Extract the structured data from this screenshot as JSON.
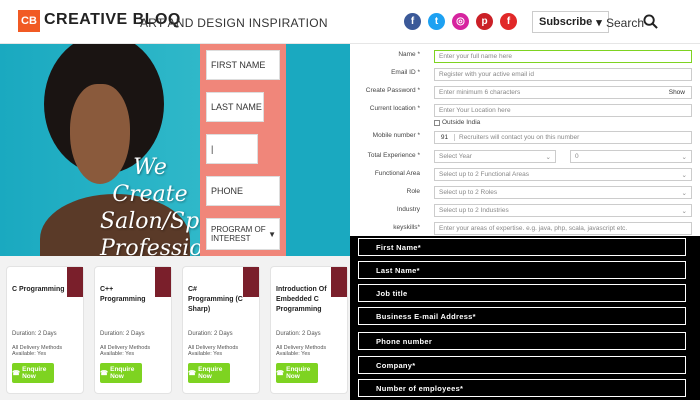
{
  "header": {
    "logo_mark": "CB",
    "logo_text": "CREATIVE BLOQ",
    "tagline": "ART AND DESIGN INSPIRATION",
    "social": [
      {
        "name": "facebook-icon",
        "glyph": "f",
        "color": "#3b5998"
      },
      {
        "name": "twitter-icon",
        "glyph": "t",
        "color": "#1da1f2"
      },
      {
        "name": "instagram-icon",
        "glyph": "◎",
        "color": "#d6249f"
      },
      {
        "name": "pinterest-icon",
        "glyph": "p",
        "color": "#cb2027"
      },
      {
        "name": "flipboard-icon",
        "glyph": "f",
        "color": "#e12828"
      }
    ],
    "subscribe_label": "Subscribe",
    "search_label": "Search"
  },
  "hero": {
    "title_lines": [
      "We Create",
      "Salon/Spa",
      "Professionals"
    ],
    "fields": [
      "FIRST NAME",
      "LAST NAME",
      "",
      "PHONE",
      "PROGRAM OF INTEREST"
    ]
  },
  "cards": [
    {
      "title": "C Programming",
      "duration": "Duration: 2 Days",
      "delivery": "All Delivery Methods Available: Yes",
      "button": "Enquire Now"
    },
    {
      "title": "C++ Programming",
      "duration": "Duration: 2 Days",
      "delivery": "All Delivery Methods Available: Yes",
      "button": "Enquire Now"
    },
    {
      "title": "C# Programming (C Sharp)",
      "duration": "Duration: 2 Days",
      "delivery": "All Delivery Methods Available: Yes",
      "button": "Enquire Now"
    },
    {
      "title": "Introduction Of Embedded C Programming",
      "duration": "Duration: 2 Days",
      "delivery": "All Delivery Methods Available: Yes",
      "button": "Enquire Now"
    }
  ],
  "registration": {
    "fields": [
      {
        "label": "Name *",
        "placeholder": "Enter your full name here"
      },
      {
        "label": "Email ID *",
        "placeholder": "Register with your active email id"
      },
      {
        "label": "Create Password *",
        "placeholder": "Enter minimum 6 characters",
        "extra": "Show"
      },
      {
        "label": "Current location *",
        "placeholder": "Enter Your Location here",
        "extra": "Outside India"
      },
      {
        "label": "Mobile number *",
        "prefix": "91",
        "placeholder": "Recruiters will contact you on this number"
      },
      {
        "label": "Total Experience *",
        "year": "Select Year",
        "month": "0"
      },
      {
        "label": "Functional Area",
        "placeholder": "Select up to 2 Functional Areas"
      },
      {
        "label": "Role",
        "placeholder": "Select up to 2 Roles"
      },
      {
        "label": "Industry",
        "placeholder": "Select up to 2 Industries"
      },
      {
        "label": "keyskills*",
        "placeholder": "Enter your areas of expertise. e.g. java, php, scala, javascript etc."
      }
    ]
  },
  "lead_form": {
    "fields": [
      "First Name*",
      "Last Name*",
      "Job title",
      "Business E-mail Address*",
      "Phone number",
      "Company*",
      "Number of employees*"
    ]
  }
}
